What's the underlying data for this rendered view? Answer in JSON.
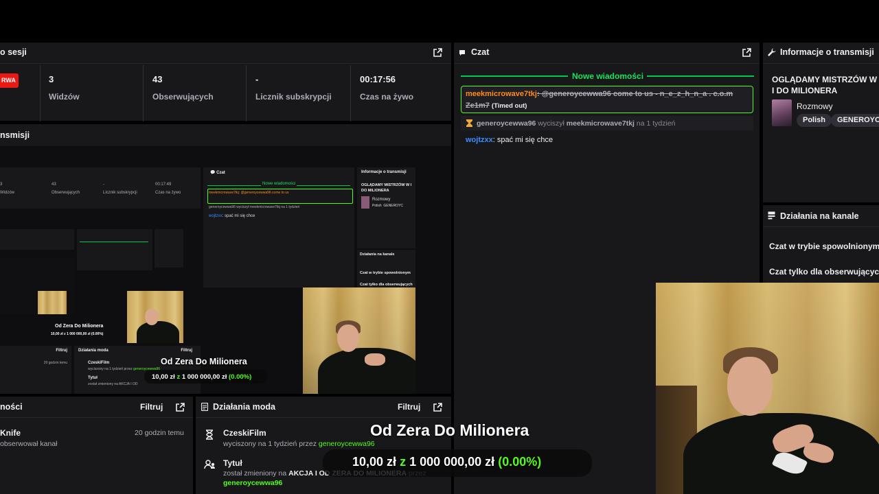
{
  "session": {
    "title": "o sesji",
    "live_badge": "RWA",
    "stats": [
      {
        "value": "3",
        "label": "Widzów"
      },
      {
        "value": "43",
        "label": "Obserwujących"
      },
      {
        "value": "-",
        "label": "Licznik subskrypcji"
      },
      {
        "value": "00:17:56",
        "label": "Czas na żywo"
      }
    ]
  },
  "preview": {
    "title": "nsmisji"
  },
  "chat": {
    "title": "Czat",
    "new_messages": "Nowe wiadomości",
    "timed_user": "meekmicrowave7tkj",
    "timed_text": ": @generoycewwa96 come to us - n_e_z_h_n_a . c.o.m",
    "timed_text2": "Ze1m7",
    "timed_note": "(Timed out)",
    "mod_user": "generoycewwa96",
    "mod_action": "wyciszył",
    "mod_target": "meekmicrowave7tkj",
    "mod_duration": "na 1 tydzień",
    "msg_user": "wojtzxx",
    "msg_text": ": spać mi się chce"
  },
  "info": {
    "title": "Informacje o transmisji",
    "stream_title": "OGLĄDAMY MISTRZÓW W I DO MILIONERA",
    "category": "Rozmowy",
    "tags": [
      "Polish",
      "GENEROYC"
    ]
  },
  "channel_actions": {
    "title": "Działania na kanale",
    "items": [
      "Czat w trybie spowolnionym",
      "Czat tylko dla obserwujących"
    ]
  },
  "notifications": {
    "title": "ności",
    "filter": "Filtruj",
    "item_name": "Knife",
    "item_time": "20 godzin temu",
    "item_desc": "obserwował kanał"
  },
  "mod_actions": {
    "title": "Działania moda",
    "filter": "Filtruj",
    "item1_name": "CzeskiFilm",
    "item1_desc": "wyciszony na 1 tydzień przez",
    "item1_by": "generoycewwa96",
    "item2_name": "Tytuł",
    "item2_desc": "został zmieniony na",
    "item2_value": "AKCJA I OD ZERA DO MILIONERA",
    "item2_by_word": "przez",
    "item2_by": "generoycewwa96"
  },
  "overlay": {
    "title": "Od Zera Do Milionera",
    "from": "10,00 zł",
    "z": "z",
    "to": "1 000 000,00 zł",
    "percent": "(0.00%)"
  },
  "nested": {
    "time": "00:17:49",
    "overlay_title": "Od Zera Do Milionera",
    "small_title": "Od Zera Do Milionera",
    "small_amount": "10,00 zł z 1 000 000,00 zł (0.00%)"
  },
  "icons": [
    "popout-icon",
    "chat-icon",
    "wrench-icon",
    "hourglass-icon",
    "users-icon",
    "channel-icon",
    "document-icon"
  ],
  "colors": {
    "panel": "#18181b",
    "accent_green": "#53fc18",
    "live_red": "#e91916",
    "timed_user": "#ff8c1a",
    "chat_user_blue": "#3a8dff"
  }
}
